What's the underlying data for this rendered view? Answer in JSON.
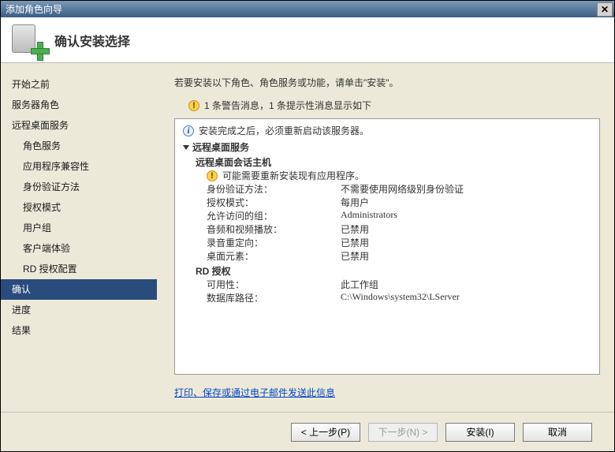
{
  "titlebar": {
    "title": "添加角色向导"
  },
  "header": {
    "title": "确认安装选择"
  },
  "sidebar": {
    "items": [
      {
        "label": "开始之前",
        "indent": false
      },
      {
        "label": "服务器角色",
        "indent": false
      },
      {
        "label": "远程桌面服务",
        "indent": false
      },
      {
        "label": "角色服务",
        "indent": true
      },
      {
        "label": "应用程序兼容性",
        "indent": true
      },
      {
        "label": "身份验证方法",
        "indent": true
      },
      {
        "label": "授权模式",
        "indent": true
      },
      {
        "label": "用户组",
        "indent": true
      },
      {
        "label": "客户端体验",
        "indent": true
      },
      {
        "label": "RD 授权配置",
        "indent": true
      },
      {
        "label": "确认",
        "indent": false,
        "selected": true
      },
      {
        "label": "进度",
        "indent": false
      },
      {
        "label": "结果",
        "indent": false
      }
    ]
  },
  "content": {
    "intro": "若要安装以下角色、角色服务或功能，请单击\"安装\"。",
    "msgline": "1 条警告消息，1 条提示性消息显示如下",
    "panel": {
      "info_restart": "安装完成之后，必须重新启动该服务器。",
      "category": "远程桌面服务",
      "session_host": "远程桌面会话主机",
      "session_warn": "可能需要重新安装现有应用程序。",
      "rows": [
        {
          "k": "身份验证方法：",
          "v": "不需要使用网络级别身份验证"
        },
        {
          "k": "授权模式：",
          "v": "每用户"
        },
        {
          "k": "允许访问的组：",
          "v": "Administrators"
        },
        {
          "k": "音频和视频播放：",
          "v": "已禁用"
        },
        {
          "k": "录音重定向：",
          "v": "已禁用"
        },
        {
          "k": "桌面元素：",
          "v": "已禁用"
        }
      ],
      "rd_lic": "RD 授权",
      "lic_rows": [
        {
          "k": "可用性：",
          "v": "此工作组"
        },
        {
          "k": "数据库路径：",
          "v": "C:\\Windows\\system32\\LServer"
        }
      ]
    },
    "link": "打印、保存或通过电子邮件发送此信息"
  },
  "footer": {
    "prev": "< 上一步(P)",
    "next": "下一步(N) >",
    "install": "安装(I)",
    "cancel": "取消"
  }
}
